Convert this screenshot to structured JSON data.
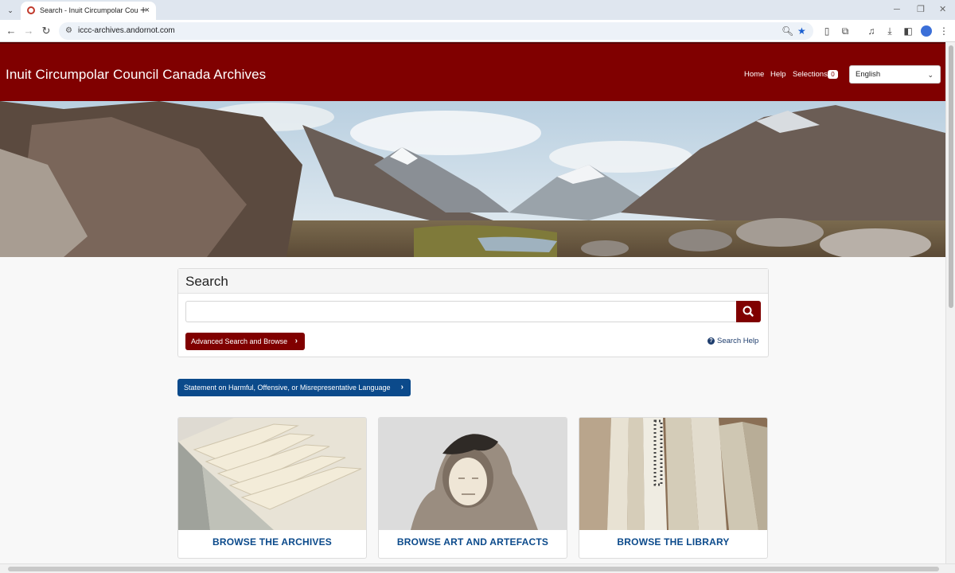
{
  "browser": {
    "tab_title": "Search - Inuit Circumpolar Cou",
    "tab_close": "×",
    "new_tab": "+",
    "url": "iccc-archives.andornot.com",
    "menu_glyph": "⌄",
    "win_min": "─",
    "win_max": "❐",
    "win_close": "✕"
  },
  "header": {
    "site_title": "Inuit Circumpolar Council Canada Archives",
    "nav": {
      "home": "Home",
      "help": "Help",
      "selections": "Selections",
      "selections_count": "0"
    },
    "language": {
      "selected": "English"
    }
  },
  "search": {
    "title": "Search",
    "value": "",
    "placeholder": "",
    "advanced_label": "Advanced Search and Browse",
    "help_label": "Search Help"
  },
  "statement": {
    "label": "Statement on Harmful, Offensive, or Misrepresentative Language"
  },
  "tiles": [
    {
      "label": "BROWSE THE ARCHIVES",
      "icon": "file-folders-image"
    },
    {
      "label": "BROWSE ART AND ARTEFACTS",
      "icon": "carved-figure-image"
    },
    {
      "label": "BROWSE THE LIBRARY",
      "icon": "book-spines-image"
    }
  ],
  "colors": {
    "brand": "#800000",
    "statement_button": "#0b4a8b",
    "link": "#1f3e6e"
  }
}
